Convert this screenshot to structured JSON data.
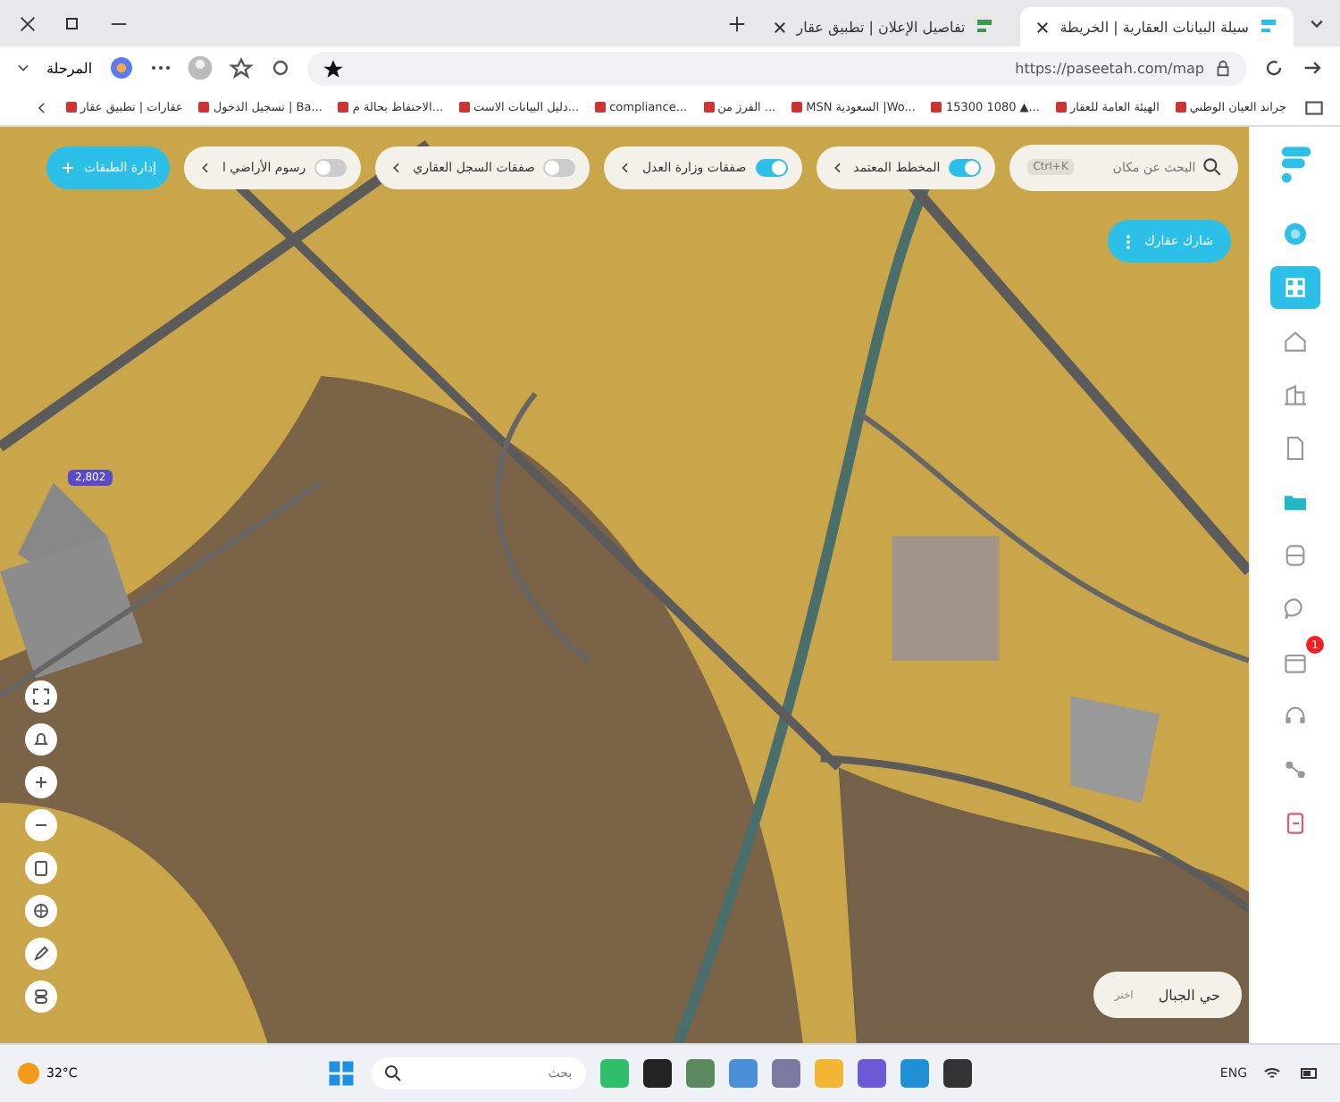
{
  "browser": {
    "tabs": [
      {
        "title": "سيلة البيانات العقارية | الخريطة",
        "selected": true
      },
      {
        "title": "تفاصيل الإعلان | تطبيق عقار",
        "selected": false
      }
    ],
    "url": "https://paseetah.com/map",
    "profile": "المرحلة",
    "bookmarks": [
      "جراند العيان الوطني",
      "الهيئة العامة للعقار",
      "15300 1080 ▲...",
      "MSN السعودية |Wo...",
      "الفرز من ...",
      "compliance...",
      "دليل البيانات الاست...",
      "الاحتفاظ بحالة م...",
      "تسجيل الدخول | Ba...",
      "عقارات | تطبيق عقار"
    ]
  },
  "map": {
    "search": {
      "placeholder": "البحث عن مكان",
      "shortcut": "Ctrl+K"
    },
    "layers": [
      {
        "label": "المخطط المعتمد",
        "on": true
      },
      {
        "label": "صفقات وزارة العدل",
        "on": true
      },
      {
        "label": "صفقات السجل العقاري",
        "on": false
      },
      {
        "label": "رسوم الأراضي ا",
        "on": false
      }
    ],
    "manage_layers": "إدارة الطبقات",
    "share_button": "شارك عقارك",
    "parcel_label": "2,802",
    "district": {
      "name": "حي الجبال",
      "tag": "اختر"
    }
  },
  "sidebar": {
    "items": [
      {
        "kind": "avatar",
        "selected": false
      },
      {
        "kind": "grid",
        "selected": true
      },
      {
        "kind": "home",
        "selected": false
      },
      {
        "kind": "building",
        "selected": false
      },
      {
        "kind": "document",
        "selected": false
      },
      {
        "kind": "folder",
        "selected": false
      },
      {
        "kind": "printer",
        "selected": false
      },
      {
        "kind": "chat",
        "selected": false
      },
      {
        "kind": "calendar",
        "selected": false,
        "badge": "1"
      },
      {
        "kind": "headset",
        "selected": false
      },
      {
        "kind": "share",
        "selected": false
      },
      {
        "kind": "logout",
        "selected": false
      }
    ]
  },
  "taskbar": {
    "weather": "32°C",
    "search_placeholder": "بحث",
    "language": "ENG"
  }
}
